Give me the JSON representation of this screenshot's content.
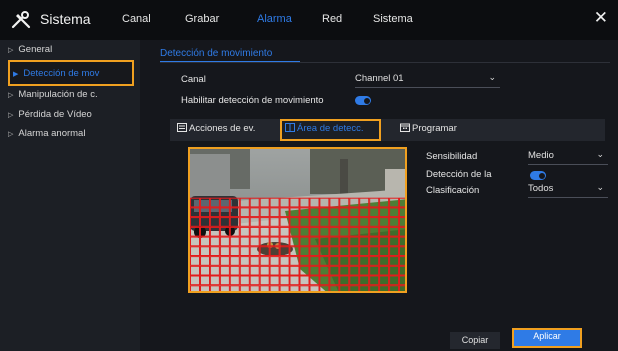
{
  "header": {
    "title": "Sistema",
    "tabs": [
      {
        "label": "Canal",
        "active": false
      },
      {
        "label": "Grabar",
        "active": false
      },
      {
        "label": "Alarma",
        "active": true
      },
      {
        "label": "Red",
        "active": false
      },
      {
        "label": "Sistema",
        "active": false
      }
    ],
    "close_glyph": "✕"
  },
  "sidebar": {
    "items": [
      {
        "label": "General",
        "active": false
      },
      {
        "label": "Detección de mov",
        "active": true
      },
      {
        "label": "Manipulación de c.",
        "active": false
      },
      {
        "label": "Pérdida de Vídeo",
        "active": false
      },
      {
        "label": "Alarma anormal",
        "active": false
      }
    ]
  },
  "main": {
    "section_title": "Detección de movimiento",
    "canal_label": "Canal",
    "canal_value": "Channel 01",
    "enable_label": "Habilitar detección de movimiento",
    "enable_on": true,
    "subtabs": [
      {
        "label": "Acciones de ev.",
        "icon": "list-icon",
        "active": false
      },
      {
        "label": "Área de detecc.",
        "icon": "area-icon",
        "active": true
      },
      {
        "label": "Programar",
        "icon": "calendar-icon",
        "active": false
      }
    ],
    "sensitivity_label": "Sensibilidad",
    "sensitivity_value": "Medio",
    "detection_label": "Detección de la",
    "detection_on": true,
    "classification_label": "Clasificación",
    "classification_value": "Todos",
    "copy_label": "Copiar",
    "apply_label": "Aplicar"
  },
  "colors": {
    "accent": "#2f7be6",
    "highlight": "#f0a020",
    "grid": "#e31c1c"
  }
}
